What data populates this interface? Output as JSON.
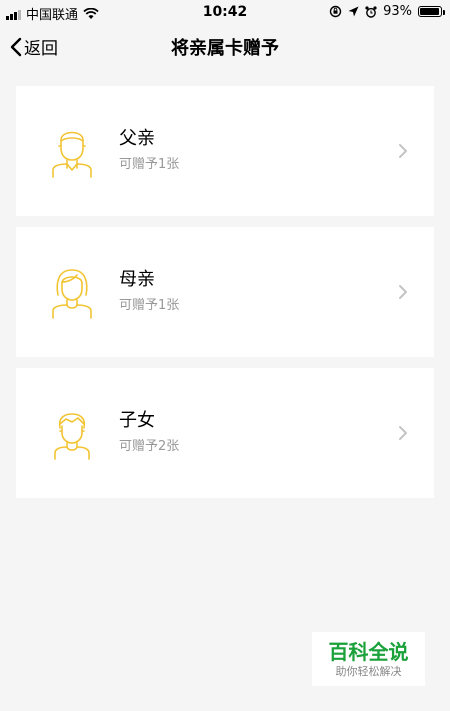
{
  "status_bar": {
    "carrier": "中国联通",
    "time": "10:42",
    "battery": "93%",
    "battery_level": 0.93,
    "icons": [
      "signal-icon",
      "wifi-icon",
      "rotation-lock-icon",
      "location-icon",
      "alarm-icon",
      "battery-icon"
    ]
  },
  "nav": {
    "back_label": "返回",
    "title": "将亲属卡赠予"
  },
  "cards": [
    {
      "name": "父亲",
      "sub": "可赠予1张",
      "icon": "father-avatar-icon"
    },
    {
      "name": "母亲",
      "sub": "可赠予1张",
      "icon": "mother-avatar-icon"
    },
    {
      "name": "子女",
      "sub": "可赠予2张",
      "icon": "child-avatar-icon"
    }
  ],
  "watermark": {
    "title": "百科全说",
    "subtitle": "助你轻松解决"
  },
  "colors": {
    "accent": "#F2C434",
    "background": "#F5F5F5",
    "watermark_green": "#1AA13A"
  }
}
